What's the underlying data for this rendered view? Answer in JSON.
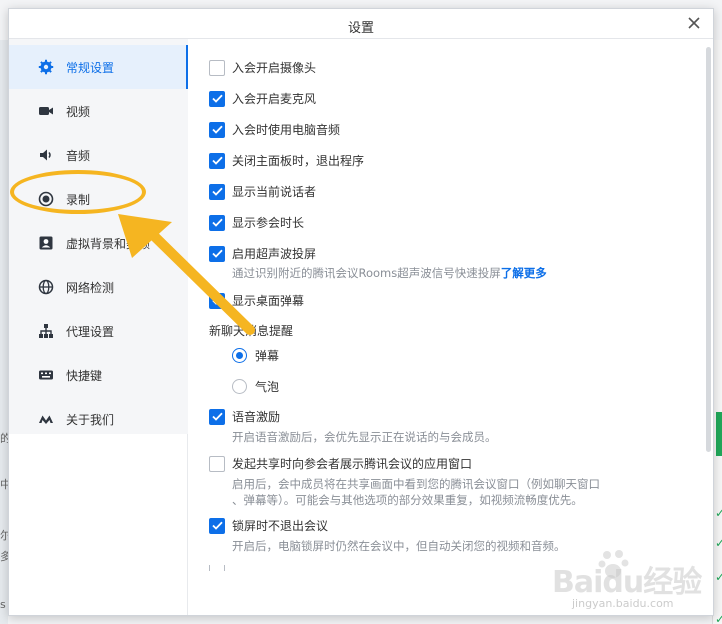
{
  "dialog": {
    "title": "设置"
  },
  "sidebar": {
    "items": [
      {
        "label": "常规设置",
        "icon": "gear-icon",
        "active": true
      },
      {
        "label": "视频",
        "icon": "video-camera-icon"
      },
      {
        "label": "音频",
        "icon": "speaker-icon"
      },
      {
        "label": "录制",
        "icon": "record-icon"
      },
      {
        "label": "虚拟背景和美颜",
        "icon": "portrait-icon"
      },
      {
        "label": "网络检测",
        "icon": "globe-icon"
      },
      {
        "label": "代理设置",
        "icon": "network-tree-icon"
      },
      {
        "label": "快捷键",
        "icon": "keyboard-icon"
      },
      {
        "label": "关于我们",
        "icon": "logo-m-icon"
      }
    ]
  },
  "settings": {
    "camera_on_join": {
      "label": "入会开启摄像头",
      "checked": false
    },
    "mic_on_join": {
      "label": "入会开启麦克风",
      "checked": true
    },
    "pc_audio_on_join": {
      "label": "入会时使用电脑音频",
      "checked": true
    },
    "exit_on_close": {
      "label": "关闭主面板时，退出程序",
      "checked": true
    },
    "show_speaker": {
      "label": "显示当前说话者",
      "checked": true
    },
    "show_duration": {
      "label": "显示参会时长",
      "checked": true
    },
    "ultrasound_cast": {
      "label": "启用超声波投屏",
      "checked": true,
      "desc": "通过识别附近的腾讯会议Rooms超声波信号快速投屏",
      "link": "了解更多"
    },
    "desktop_danmu": {
      "label": "显示桌面弹幕",
      "checked": true
    },
    "chat_reminder": {
      "label": "新聊天消息提醒",
      "options": [
        {
          "label": "弹幕",
          "selected": true
        },
        {
          "label": "气泡",
          "selected": false
        }
      ]
    },
    "voice_motivation": {
      "label": "语音激励",
      "checked": true,
      "desc": "开启语音激励后，会优先显示正在说话的与会成员。"
    },
    "share_app_window": {
      "label": "发起共享时向参会者展示腾讯会议的应用窗口",
      "checked": false,
      "desc_line1": "启用后，会中成员将在共享画面中看到您的腾讯会议窗口（例如聊天窗口",
      "desc_line2": "、弹幕等）。可能会与其他选项的部分效果重复，如视频流畅度优先。"
    },
    "lock_screen_stay": {
      "label": "锁屏时不退出会议",
      "checked": true,
      "desc": "开启后，电脑锁屏时仍然在会议中，但自动关闭您的视频和音频。"
    }
  },
  "background": {
    "left_snippets": [
      "的",
      "中",
      "尔",
      "多",
      "s"
    ]
  },
  "watermark": {
    "main": "Baidu经验",
    "sub": "jingyan.baidu.com"
  },
  "colors": {
    "accent": "#0d6fe8",
    "annotation": "#f5b521"
  }
}
